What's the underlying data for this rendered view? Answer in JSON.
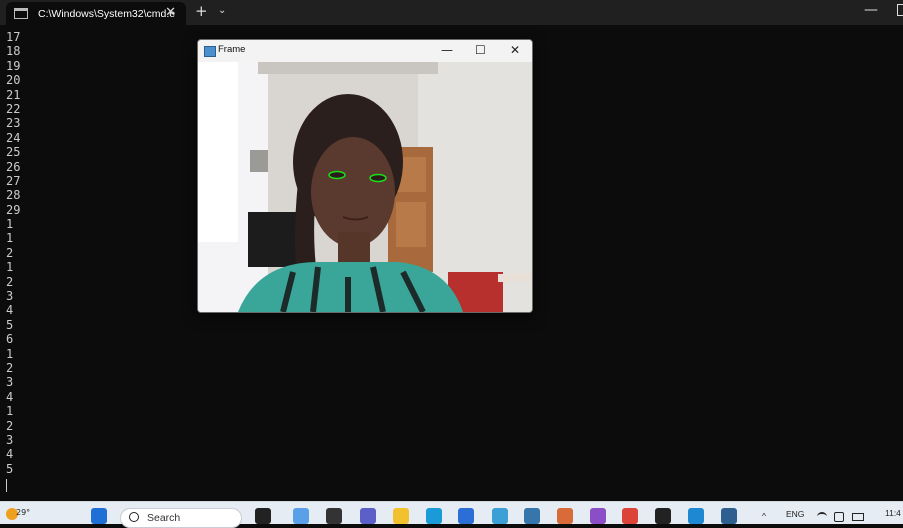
{
  "terminal": {
    "tab_title": "C:\\Windows\\System32\\cmd.e",
    "close_glyph": "✕",
    "new_tab_glyph": "+",
    "dropdown_glyph": "⌄",
    "minimize_glyph": "—",
    "output_lines": [
      "17",
      "18",
      "19",
      "20",
      "21",
      "22",
      "23",
      "24",
      "25",
      "26",
      "27",
      "28",
      "29",
      "1",
      "1",
      "2",
      "1",
      "2",
      "3",
      "4",
      "5",
      "6",
      "1",
      "2",
      "3",
      "4",
      "1",
      "2",
      "3",
      "4",
      "5"
    ]
  },
  "frame_window": {
    "title": "Frame",
    "minimize_glyph": "—",
    "maximize_glyph": "☐",
    "close_glyph": "✕"
  },
  "taskbar": {
    "weather_temp": "29°",
    "search_placeholder": "Search",
    "language": "ENG",
    "clock_partial": "11:4",
    "tray_arrow": "^",
    "apps": [
      {
        "name": "start",
        "color": "#1f6fd6"
      },
      {
        "name": "copilot",
        "color": "#222"
      },
      {
        "name": "widgets",
        "color": "#5aa0e8"
      },
      {
        "name": "task-view",
        "color": "#333"
      },
      {
        "name": "teams",
        "color": "#5b5fc7"
      },
      {
        "name": "file-explorer",
        "color": "#f2c12e"
      },
      {
        "name": "edge",
        "color": "#1a9bd7"
      },
      {
        "name": "store",
        "color": "#2b6fd6"
      },
      {
        "name": "mongodb",
        "color": "#3aa0d6"
      },
      {
        "name": "python",
        "color": "#3776ab"
      },
      {
        "name": "games",
        "color": "#d96b3a"
      },
      {
        "name": "visual-studio",
        "color": "#8b4ec7"
      },
      {
        "name": "chrome",
        "color": "#db4437"
      },
      {
        "name": "terminal",
        "color": "#222"
      },
      {
        "name": "vscode",
        "color": "#1e88d2"
      },
      {
        "name": "cmd",
        "color": "#2e5f8f"
      }
    ]
  },
  "colors": {
    "console_bg": "#0c0c0c",
    "console_text": "#cccccc",
    "titlebar": "#202020",
    "taskbar": "#e6ecf3",
    "eye_outline": "#19e019"
  }
}
